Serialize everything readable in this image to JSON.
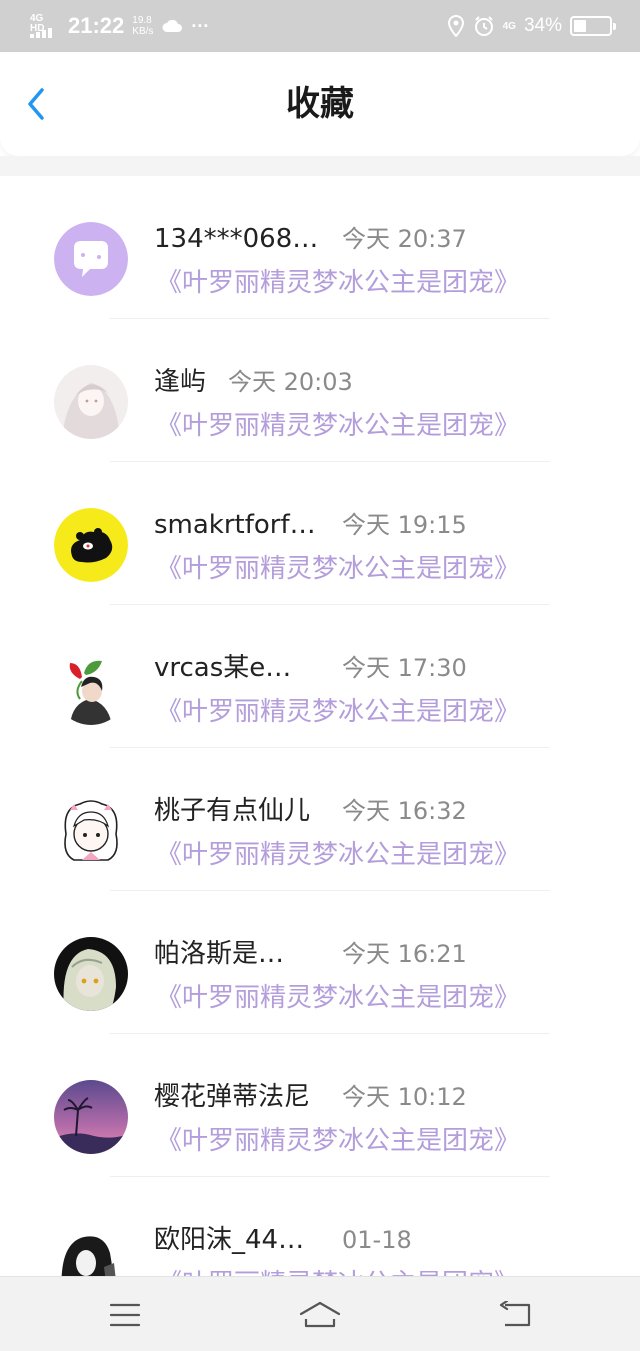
{
  "status_bar": {
    "network_type": "4G HD",
    "time": "21:22",
    "speed_value": "19.8",
    "speed_unit": "KB/s",
    "more": "···",
    "data_network": "4G",
    "battery": "34%",
    "battery_level": 0.34
  },
  "header": {
    "title": "收藏",
    "back_icon": "chevron-left-icon"
  },
  "colors": {
    "accent": "#2196f3",
    "book_title": "#b39ddb",
    "status_bar_bg": "#d0d0d0"
  },
  "favorites": [
    {
      "name": "134***068…",
      "time": "今天 20:37",
      "book": "《叶罗丽精灵梦冰公主是团宠》"
    },
    {
      "name": "逢屿",
      "time": "今天 20:03",
      "book": "《叶罗丽精灵梦冰公主是团宠》"
    },
    {
      "name": "smakrtforf…",
      "time": "今天 19:15",
      "book": "《叶罗丽精灵梦冰公主是团宠》"
    },
    {
      "name": "vrcas某e…",
      "time": "今天 17:30",
      "book": "《叶罗丽精灵梦冰公主是团宠》"
    },
    {
      "name": "桃子有点仙儿",
      "time": "今天 16:32",
      "book": "《叶罗丽精灵梦冰公主是团宠》"
    },
    {
      "name": "帕洛斯是…",
      "time": "今天 16:21",
      "book": "《叶罗丽精灵梦冰公主是团宠》"
    },
    {
      "name": "樱花弹蒂法尼",
      "time": "今天 10:12",
      "book": "《叶罗丽精灵梦冰公主是团宠》"
    },
    {
      "name": "欧阳沫_44…",
      "time": "01-18",
      "book": "《叶罗丽精灵梦冰公主是团宠》"
    }
  ],
  "nav": {
    "menu_icon": "menu-icon",
    "home_icon": "home-icon",
    "back_icon": "back-icon"
  }
}
